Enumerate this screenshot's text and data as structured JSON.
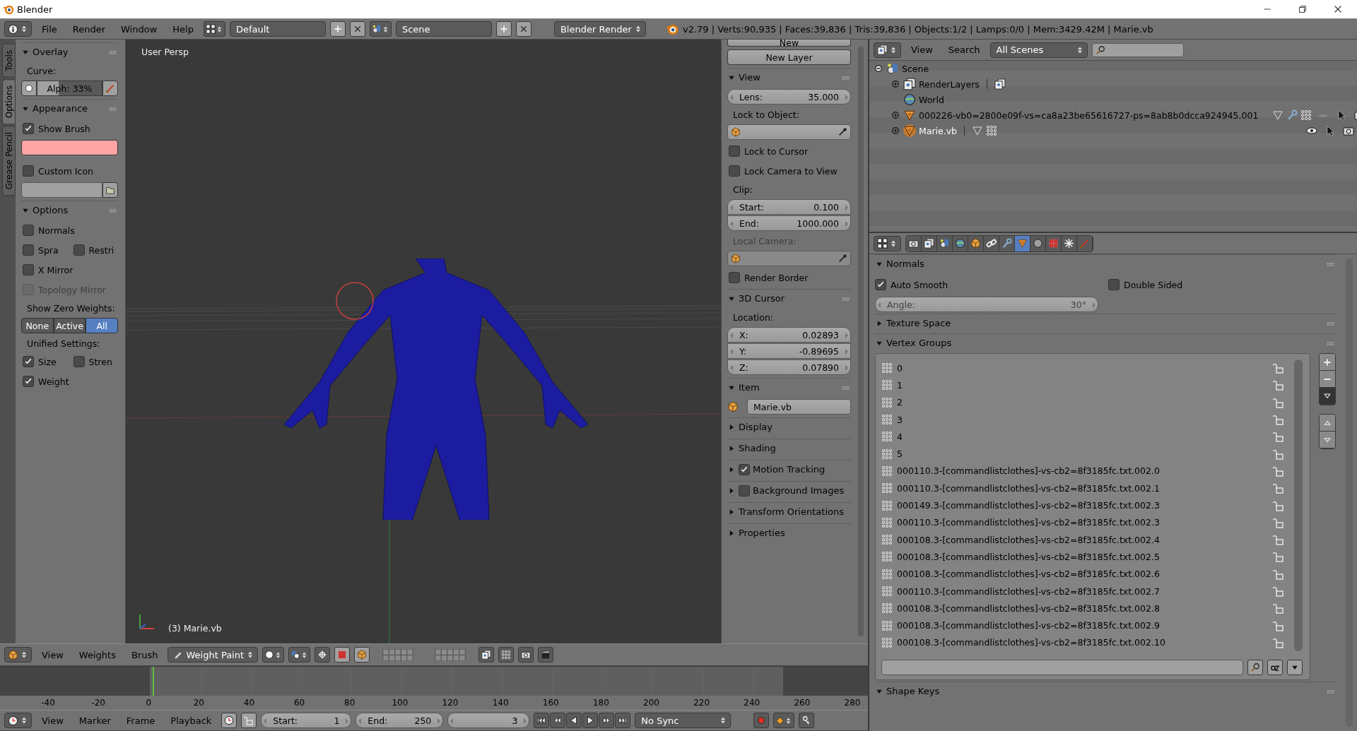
{
  "window": {
    "title": "Blender"
  },
  "info_header": {
    "menu": [
      "File",
      "Render",
      "Window",
      "Help"
    ],
    "layout": "Default",
    "scene": "Scene",
    "engine": "Blender Render",
    "stats": "v2.79 | Verts:90,935 | Faces:39,836 | Tris:39,836 | Objects:1/2 | Lamps:0/0 | Mem:3429.42M | Marie.vb"
  },
  "tool_tabs": [
    {
      "label": "Tools",
      "selected": false
    },
    {
      "label": "Options",
      "selected": true
    },
    {
      "label": "Grease Pencil",
      "selected": false
    }
  ],
  "tool_shelf": {
    "overlay": {
      "title": "Overlay",
      "curve_label": "Curve:",
      "alpha": "Alph: 33%",
      "level": 0.33
    },
    "appearance": {
      "title": "Appearance",
      "show_brush": {
        "label": "Show Brush",
        "checked": true
      },
      "custom_icon": {
        "label": "Custom Icon",
        "checked": false
      }
    },
    "options": {
      "title": "Options",
      "rows": [
        {
          "items": [
            {
              "label": "Normals",
              "checked": false,
              "disabled": false
            }
          ]
        },
        {
          "items": [
            {
              "label": "Spra",
              "checked": false,
              "disabled": false
            },
            {
              "label": "Restri",
              "checked": false,
              "disabled": false
            }
          ]
        },
        {
          "items": [
            {
              "label": "X Mirror",
              "checked": false,
              "disabled": false
            }
          ]
        },
        {
          "items": [
            {
              "label": "Topology Mirror",
              "checked": false,
              "disabled": true
            }
          ]
        }
      ],
      "zero_weights_label": "Show Zero Weights:",
      "zero_weights": [
        {
          "label": "None",
          "selected": false
        },
        {
          "label": "Active",
          "selected": false
        },
        {
          "label": "All",
          "selected": true
        }
      ],
      "unified_label": "Unified Settings:",
      "unified_rows": [
        {
          "items": [
            {
              "label": "Size",
              "checked": true,
              "disabled": false
            },
            {
              "label": "Stren",
              "checked": false,
              "disabled": false
            }
          ]
        },
        {
          "items": [
            {
              "label": "Weight",
              "checked": true,
              "disabled": false
            }
          ]
        }
      ]
    }
  },
  "viewport": {
    "view_name": "User Persp",
    "object_label": "(3) Marie.vb"
  },
  "n_panel": {
    "new_button": "New",
    "new_layer": "New Layer",
    "view": {
      "title": "View",
      "lens": {
        "label": "Lens:",
        "value": "35.000"
      },
      "lock_label": "Lock to Object:",
      "locks": [
        {
          "label": "Lock to Cursor",
          "checked": false
        },
        {
          "label": "Lock Camera to View",
          "checked": false
        }
      ],
      "clip_label": "Clip:",
      "clip": [
        {
          "label": "Start:",
          "value": "0.100"
        },
        {
          "label": "End:",
          "value": "1000.000"
        }
      ],
      "local_camera_label": "Local Camera:",
      "render_border": {
        "label": "Render Border",
        "checked": false
      }
    },
    "cursor": {
      "title": "3D Cursor",
      "location_label": "Location:",
      "coords": [
        {
          "label": "X:",
          "value": "0.02893"
        },
        {
          "label": "Y:",
          "value": "-0.89695"
        },
        {
          "label": "Z:",
          "value": "0.07890"
        }
      ]
    },
    "item": {
      "title": "Item",
      "name": "Marie.vb"
    },
    "collapsed": [
      {
        "title": "Display",
        "kind": "plain"
      },
      {
        "title": "Shading",
        "kind": "plain"
      },
      {
        "title": "Motion Tracking",
        "kind": "check",
        "checked": true
      },
      {
        "title": "Background Images",
        "kind": "check",
        "checked": false
      },
      {
        "title": "Transform Orientations",
        "kind": "plain"
      },
      {
        "title": "Properties",
        "kind": "plain"
      }
    ]
  },
  "viewport_header": {
    "menu": [
      "View",
      "Weights",
      "Brush"
    ],
    "mode": "Weight Paint"
  },
  "timeline": {
    "ruler": [
      "-40",
      "-20",
      "0",
      "20",
      "40",
      "60",
      "80",
      "100",
      "120",
      "140",
      "160",
      "180",
      "200",
      "220",
      "240",
      "260",
      "280"
    ],
    "menu": [
      "View",
      "Marker",
      "Frame",
      "Playback"
    ],
    "start": {
      "label": "Start:",
      "value": "1"
    },
    "end": {
      "label": "End:",
      "value": "250"
    },
    "current": "3",
    "sync": "No Sync"
  },
  "outliner": {
    "menu": [
      "View",
      "Search"
    ],
    "filter": "All Scenes",
    "tree": [
      {
        "label": "Scene",
        "kind": "scene",
        "expanded": true,
        "selected": false,
        "children": [
          {
            "label": "RenderLayers",
            "kind": "renderlayers",
            "expanded": false,
            "selected": false
          },
          {
            "label": "World",
            "kind": "world",
            "selected": false
          },
          {
            "label": "000226-vb0=2800e09f-vs=ca8a23be65616727-ps=8ab8b0dcca924945.001",
            "kind": "mesh",
            "expanded": false,
            "selected": false,
            "visible": false
          },
          {
            "label": "Marie.vb",
            "kind": "mesh",
            "expanded": false,
            "selected": true,
            "visible": true
          }
        ]
      }
    ]
  },
  "properties": {
    "tabs": [
      {
        "kind": "camera",
        "selected": false
      },
      {
        "kind": "layers",
        "selected": false
      },
      {
        "kind": "scene",
        "selected": false
      },
      {
        "kind": "globe",
        "selected": false
      },
      {
        "kind": "cube",
        "selected": false
      },
      {
        "kind": "link",
        "selected": false
      },
      {
        "kind": "wrench",
        "selected": false
      },
      {
        "kind": "mesh",
        "selected": true
      },
      {
        "kind": "sphere",
        "selected": false
      },
      {
        "kind": "checker",
        "selected": false
      },
      {
        "kind": "sparkle",
        "selected": false
      },
      {
        "kind": "brush",
        "selected": false
      }
    ],
    "normals": {
      "title": "Normals",
      "auto_smooth": {
        "label": "Auto Smooth",
        "checked": true
      },
      "double_sided": {
        "label": "Double Sided",
        "checked": false
      },
      "angle": {
        "label": "Angle:",
        "value": "30°"
      }
    },
    "texture_space": "Texture Space",
    "vertex_groups": {
      "title": "Vertex Groups",
      "items": [
        "0",
        "1",
        "2",
        "3",
        "4",
        "5",
        "000110.3-[commandlistclothes]-vs-cb2=8f3185fc.txt.002.0",
        "000110.3-[commandlistclothes]-vs-cb2=8f3185fc.txt.002.1",
        "000149.3-[commandlistclothes]-vs-cb2=8f3185fc.txt.002.3",
        "000110.3-[commandlistclothes]-vs-cb2=8f3185fc.txt.002.3",
        "000108.3-[commandlistclothes]-vs-cb2=8f3185fc.txt.002.4",
        "000108.3-[commandlistclothes]-vs-cb2=8f3185fc.txt.002.5",
        "000108.3-[commandlistclothes]-vs-cb2=8f3185fc.txt.002.6",
        "000110.3-[commandlistclothes]-vs-cb2=8f3185fc.txt.002.7",
        "000108.3-[commandlistclothes]-vs-cb2=8f3185fc.txt.002.8",
        "000108.3-[commandlistclothes]-vs-cb2=8f3185fc.txt.002.9",
        "000108.3-[commandlistclothes]-vs-cb2=8f3185fc.txt.002.10"
      ]
    },
    "shape_keys": "Shape Keys"
  }
}
